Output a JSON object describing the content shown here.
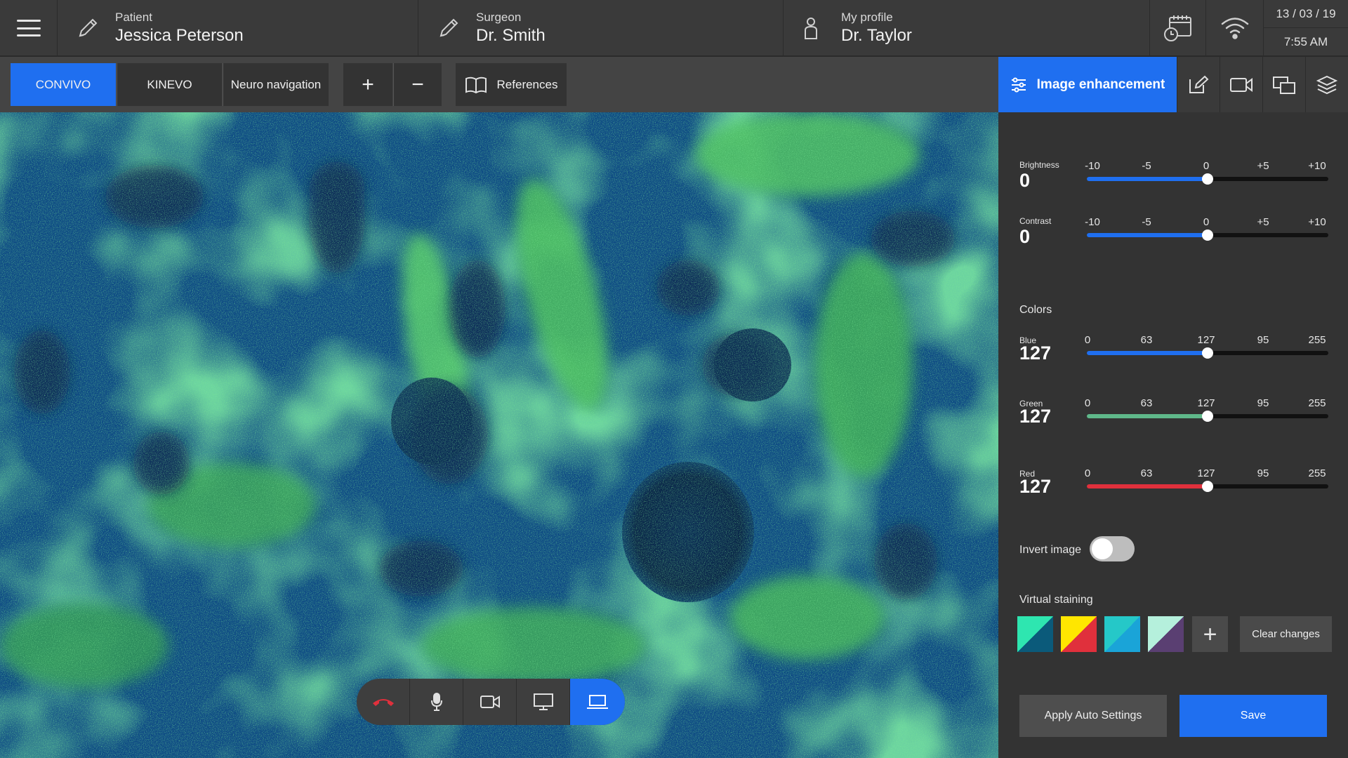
{
  "header": {
    "patient": {
      "label": "Patient",
      "value": "Jessica Peterson"
    },
    "surgeon": {
      "label": "Surgeon",
      "value": "Dr. Smith"
    },
    "profile": {
      "label": "My profile",
      "value": "Dr. Taylor"
    },
    "date": "13 / 03 / 19",
    "time": "7:55 AM"
  },
  "toolbar": {
    "tabs": [
      {
        "label": "CONVIVO",
        "active": true
      },
      {
        "label": "KINEVO",
        "active": false
      },
      {
        "label": "Neuro navigation",
        "active": false
      }
    ],
    "zoom_in": "+",
    "zoom_out": "−",
    "references_label": "References"
  },
  "right_tabs": {
    "active_label": "Image enhancement",
    "icons": [
      "edit-icon",
      "video-camera-icon",
      "windows-icon",
      "layers-icon"
    ]
  },
  "panel": {
    "brightness": {
      "label": "Brightness",
      "value": "0",
      "ticks": [
        "-10",
        "-5",
        "0",
        "+5",
        "+10"
      ],
      "level": 0.5,
      "color": "#1f6ff0"
    },
    "contrast": {
      "label": "Contrast",
      "value": "0",
      "ticks": [
        "-10",
        "-5",
        "0",
        "+5",
        "+10"
      ],
      "level": 0.5,
      "color": "#1f6ff0"
    },
    "colors_label": "Colors",
    "blue": {
      "label": "Blue",
      "value": "127",
      "ticks": [
        "0",
        "63",
        "127",
        "95",
        "255"
      ],
      "level": 0.5,
      "color": "#1f6ff0"
    },
    "green": {
      "label": "Green",
      "value": "127",
      "ticks": [
        "0",
        "63",
        "127",
        "95",
        "255"
      ],
      "level": 0.5,
      "color": "#5fb88a"
    },
    "red": {
      "label": "Red",
      "value": "127",
      "ticks": [
        "0",
        "63",
        "127",
        "95",
        "255"
      ],
      "level": 0.5,
      "color": "#e0303c"
    },
    "invert_label": "Invert image",
    "invert_on": false,
    "staining_label": "Virtual staining",
    "swatches": [
      {
        "a": "#0b5a7a",
        "b": "#2ee6b0"
      },
      {
        "a": "#e0303c",
        "b": "#ffe600"
      },
      {
        "a": "#1aa4d8",
        "b": "#25c8c8"
      },
      {
        "a": "#5a3f72",
        "b": "#b5f0dc"
      }
    ],
    "add_swatch": "+",
    "clear_label": "Clear changes",
    "auto_label": "Apply Auto Settings",
    "save_label": "Save"
  },
  "colors": {
    "accent": "#1f6ff0",
    "end_call": "#e0303c"
  }
}
